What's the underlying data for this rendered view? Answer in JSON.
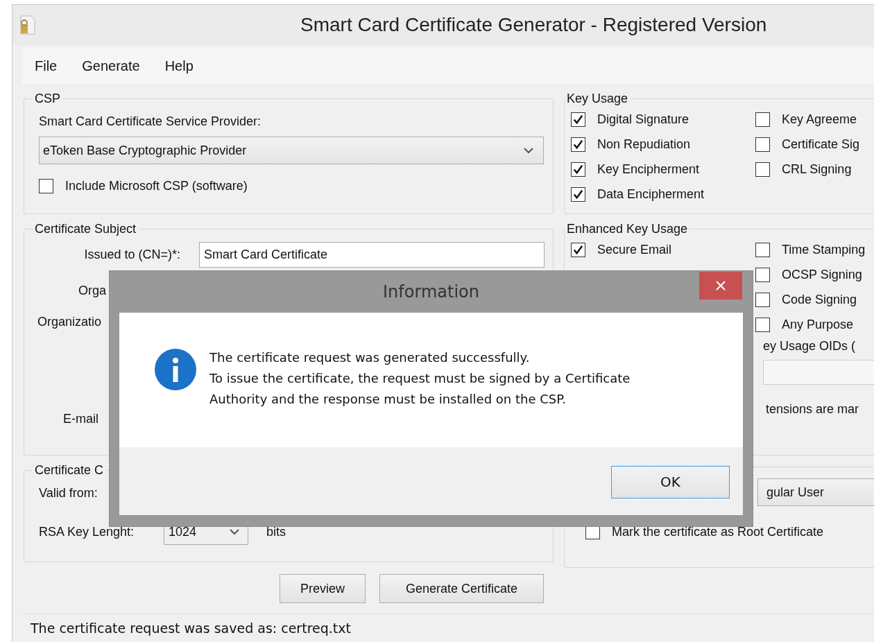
{
  "window": {
    "title": "Smart Card Certificate Generator - Registered Version"
  },
  "menu": [
    "File",
    "Generate",
    "Help"
  ],
  "csp": {
    "legend": "CSP",
    "provider_label": "Smart Card Certificate Service Provider:",
    "provider": "eToken Base Cryptographic Provider",
    "include_ms": {
      "label": "Include Microsoft CSP (software)",
      "checked": false
    }
  },
  "subject": {
    "legend": "Certificate Subject",
    "fields": [
      {
        "kind": "input",
        "label": "Issued to (CN=)*:",
        "value": "Smart Card Certificate"
      },
      {
        "kind": "covered",
        "label": "Orga"
      },
      {
        "kind": "covered",
        "label": "Organizatio"
      },
      {
        "kind": "covered",
        "label": "E-mail"
      }
    ]
  },
  "options": {
    "legend": "Certificate C",
    "valid_from_label": "Valid from:",
    "rsa_label": "RSA Key Lenght:",
    "rsa_value": "1024",
    "rsa_unit": "bits"
  },
  "buttons": [
    "Preview",
    "Generate Certificate"
  ],
  "key_usage": {
    "legend": "Key Usage",
    "columns": [
      [
        {
          "label": "Digital Signature",
          "checked": true
        },
        {
          "label": "Non Repudiation",
          "checked": true
        },
        {
          "label": "Key Encipherment",
          "checked": true
        },
        {
          "label": "Data Encipherment",
          "checked": true
        }
      ],
      [
        {
          "label": "Key Agreeme",
          "checked": false
        },
        {
          "label": "Certificate Sig",
          "checked": false
        },
        {
          "label": "CRL Signing",
          "checked": false
        }
      ]
    ]
  },
  "enhanced": {
    "legend": "Enhanced Key Usage",
    "columns": [
      [
        {
          "label": "Secure Email",
          "checked": true
        }
      ],
      [
        {
          "label": "Time Stamping",
          "checked": false
        },
        {
          "label": "OCSP Signing",
          "checked": false
        },
        {
          "label": "Code Signing",
          "checked": false
        },
        {
          "label": "Any Purpose",
          "checked": false
        }
      ]
    ],
    "oids_label": "ey Usage OIDs (",
    "critical_label": "tensions are mar"
  },
  "user_type": {
    "value": "gular User"
  },
  "root": {
    "label": "Mark the certificate as Root Certificate",
    "checked": false
  },
  "status_bar": "The certificate request was saved as: certreq.txt",
  "dialog": {
    "title": "Information",
    "message": "The certificate request was generated successfully.\nTo issue the certificate, the request must be signed by a Certificate\nAuthority and the response must be installed on the CSP.",
    "button": "OK"
  }
}
